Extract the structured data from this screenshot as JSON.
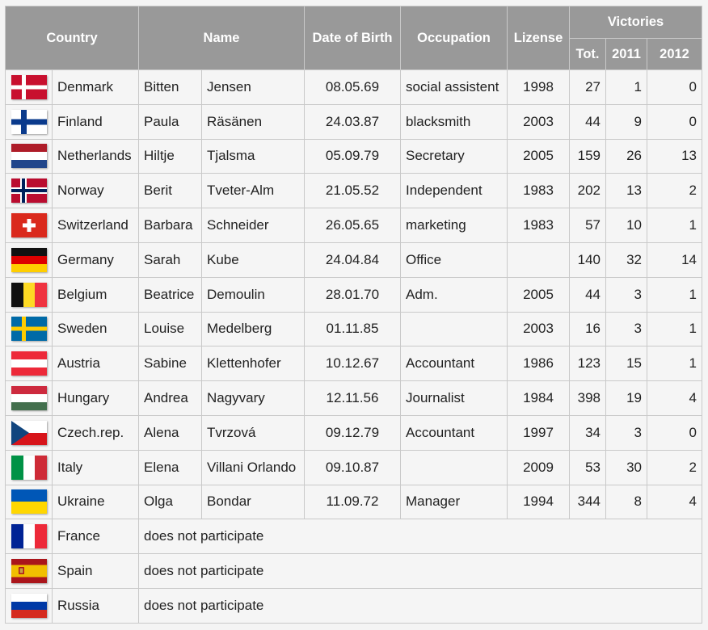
{
  "header": {
    "country": "Country",
    "name": "Name",
    "dob": "Date of Birth",
    "occupation": "Occupation",
    "license": "Lizense",
    "victories": "Victories",
    "tot": "Tot.",
    "y2011": "2011",
    "y2012": "2012"
  },
  "rows": [
    {
      "flag": "denmark-flag-icon",
      "country": "Denmark",
      "first": "Bitten",
      "last": "Jensen",
      "dob": "08.05.69",
      "occupation": "social assistent",
      "license": "1998",
      "tot": "27",
      "y2011": "1",
      "y2012": "0"
    },
    {
      "flag": "finland-flag-icon",
      "country": "Finland",
      "first": "Paula",
      "last": "Räsänen",
      "dob": "24.03.87",
      "occupation": "blacksmith",
      "license": "2003",
      "tot": "44",
      "y2011": "9",
      "y2012": "0"
    },
    {
      "flag": "netherlands-flag-icon",
      "country": "Netherlands",
      "first": "Hiltje",
      "last": "Tjalsma",
      "dob": "05.09.79",
      "occupation": "Secretary",
      "license": "2005",
      "tot": "159",
      "y2011": "26",
      "y2012": "13"
    },
    {
      "flag": "norway-flag-icon",
      "country": "Norway",
      "first": "Berit",
      "last": "Tveter-Alm",
      "dob": "21.05.52",
      "occupation": "Independent",
      "license": "1983",
      "tot": "202",
      "y2011": "13",
      "y2012": "2"
    },
    {
      "flag": "switzerland-flag-icon",
      "country": "Switzerland",
      "first": "Barbara",
      "last": "Schneider",
      "dob": "26.05.65",
      "occupation": "marketing",
      "license": "1983",
      "tot": "57",
      "y2011": "10",
      "y2012": "1"
    },
    {
      "flag": "germany-flag-icon",
      "country": "Germany",
      "first": "Sarah",
      "last": "Kube",
      "dob": "24.04.84",
      "occupation": "Office",
      "license": "",
      "tot": "140",
      "y2011": "32",
      "y2012": "14"
    },
    {
      "flag": "belgium-flag-icon",
      "country": "Belgium",
      "first": "Beatrice",
      "last": "Demoulin",
      "dob": "28.01.70",
      "occupation": "Adm.",
      "license": "2005",
      "tot": "44",
      "y2011": "3",
      "y2012": "1"
    },
    {
      "flag": "sweden-flag-icon",
      "country": "Sweden",
      "first": "Louise",
      "last": "Medelberg",
      "dob": "01.11.85",
      "occupation": "",
      "license": "2003",
      "tot": "16",
      "y2011": "3",
      "y2012": "1"
    },
    {
      "flag": "austria-flag-icon",
      "country": "Austria",
      "first": "Sabine",
      "last": "Klettenhofer",
      "dob": "10.12.67",
      "occupation": "Accountant",
      "license": "1986",
      "tot": "123",
      "y2011": "15",
      "y2012": "1"
    },
    {
      "flag": "hungary-flag-icon",
      "country": "Hungary",
      "first": "Andrea",
      "last": "Nagyvary",
      "dob": "12.11.56",
      "occupation": "Journalist",
      "license": "1984",
      "tot": "398",
      "y2011": "19",
      "y2012": "4"
    },
    {
      "flag": "czech-flag-icon",
      "country": "Czech.rep.",
      "first": "Alena",
      "last": "Tvrzová",
      "dob": "09.12.79",
      "occupation": "Accountant",
      "license": "1997",
      "tot": "34",
      "y2011": "3",
      "y2012": "0"
    },
    {
      "flag": "italy-flag-icon",
      "country": "Italy",
      "first": "Elena",
      "last": "Villani Orlando",
      "dob": "09.10.87",
      "occupation": "",
      "license": "2009",
      "tot": "53",
      "y2011": "30",
      "y2012": "2"
    },
    {
      "flag": "ukraine-flag-icon",
      "country": "Ukraine",
      "first": "Olga",
      "last": "Bondar",
      "dob": "11.09.72",
      "occupation": "Manager",
      "license": "1994",
      "tot": "344",
      "y2011": "8",
      "y2012": "4"
    }
  ],
  "absent": [
    {
      "flag": "france-flag-icon",
      "country": "France",
      "note": "does not participate"
    },
    {
      "flag": "spain-flag-icon",
      "country": "Spain",
      "note": "does not participate"
    },
    {
      "flag": "russia-flag-icon",
      "country": "Russia",
      "note": "does not participate"
    }
  ]
}
